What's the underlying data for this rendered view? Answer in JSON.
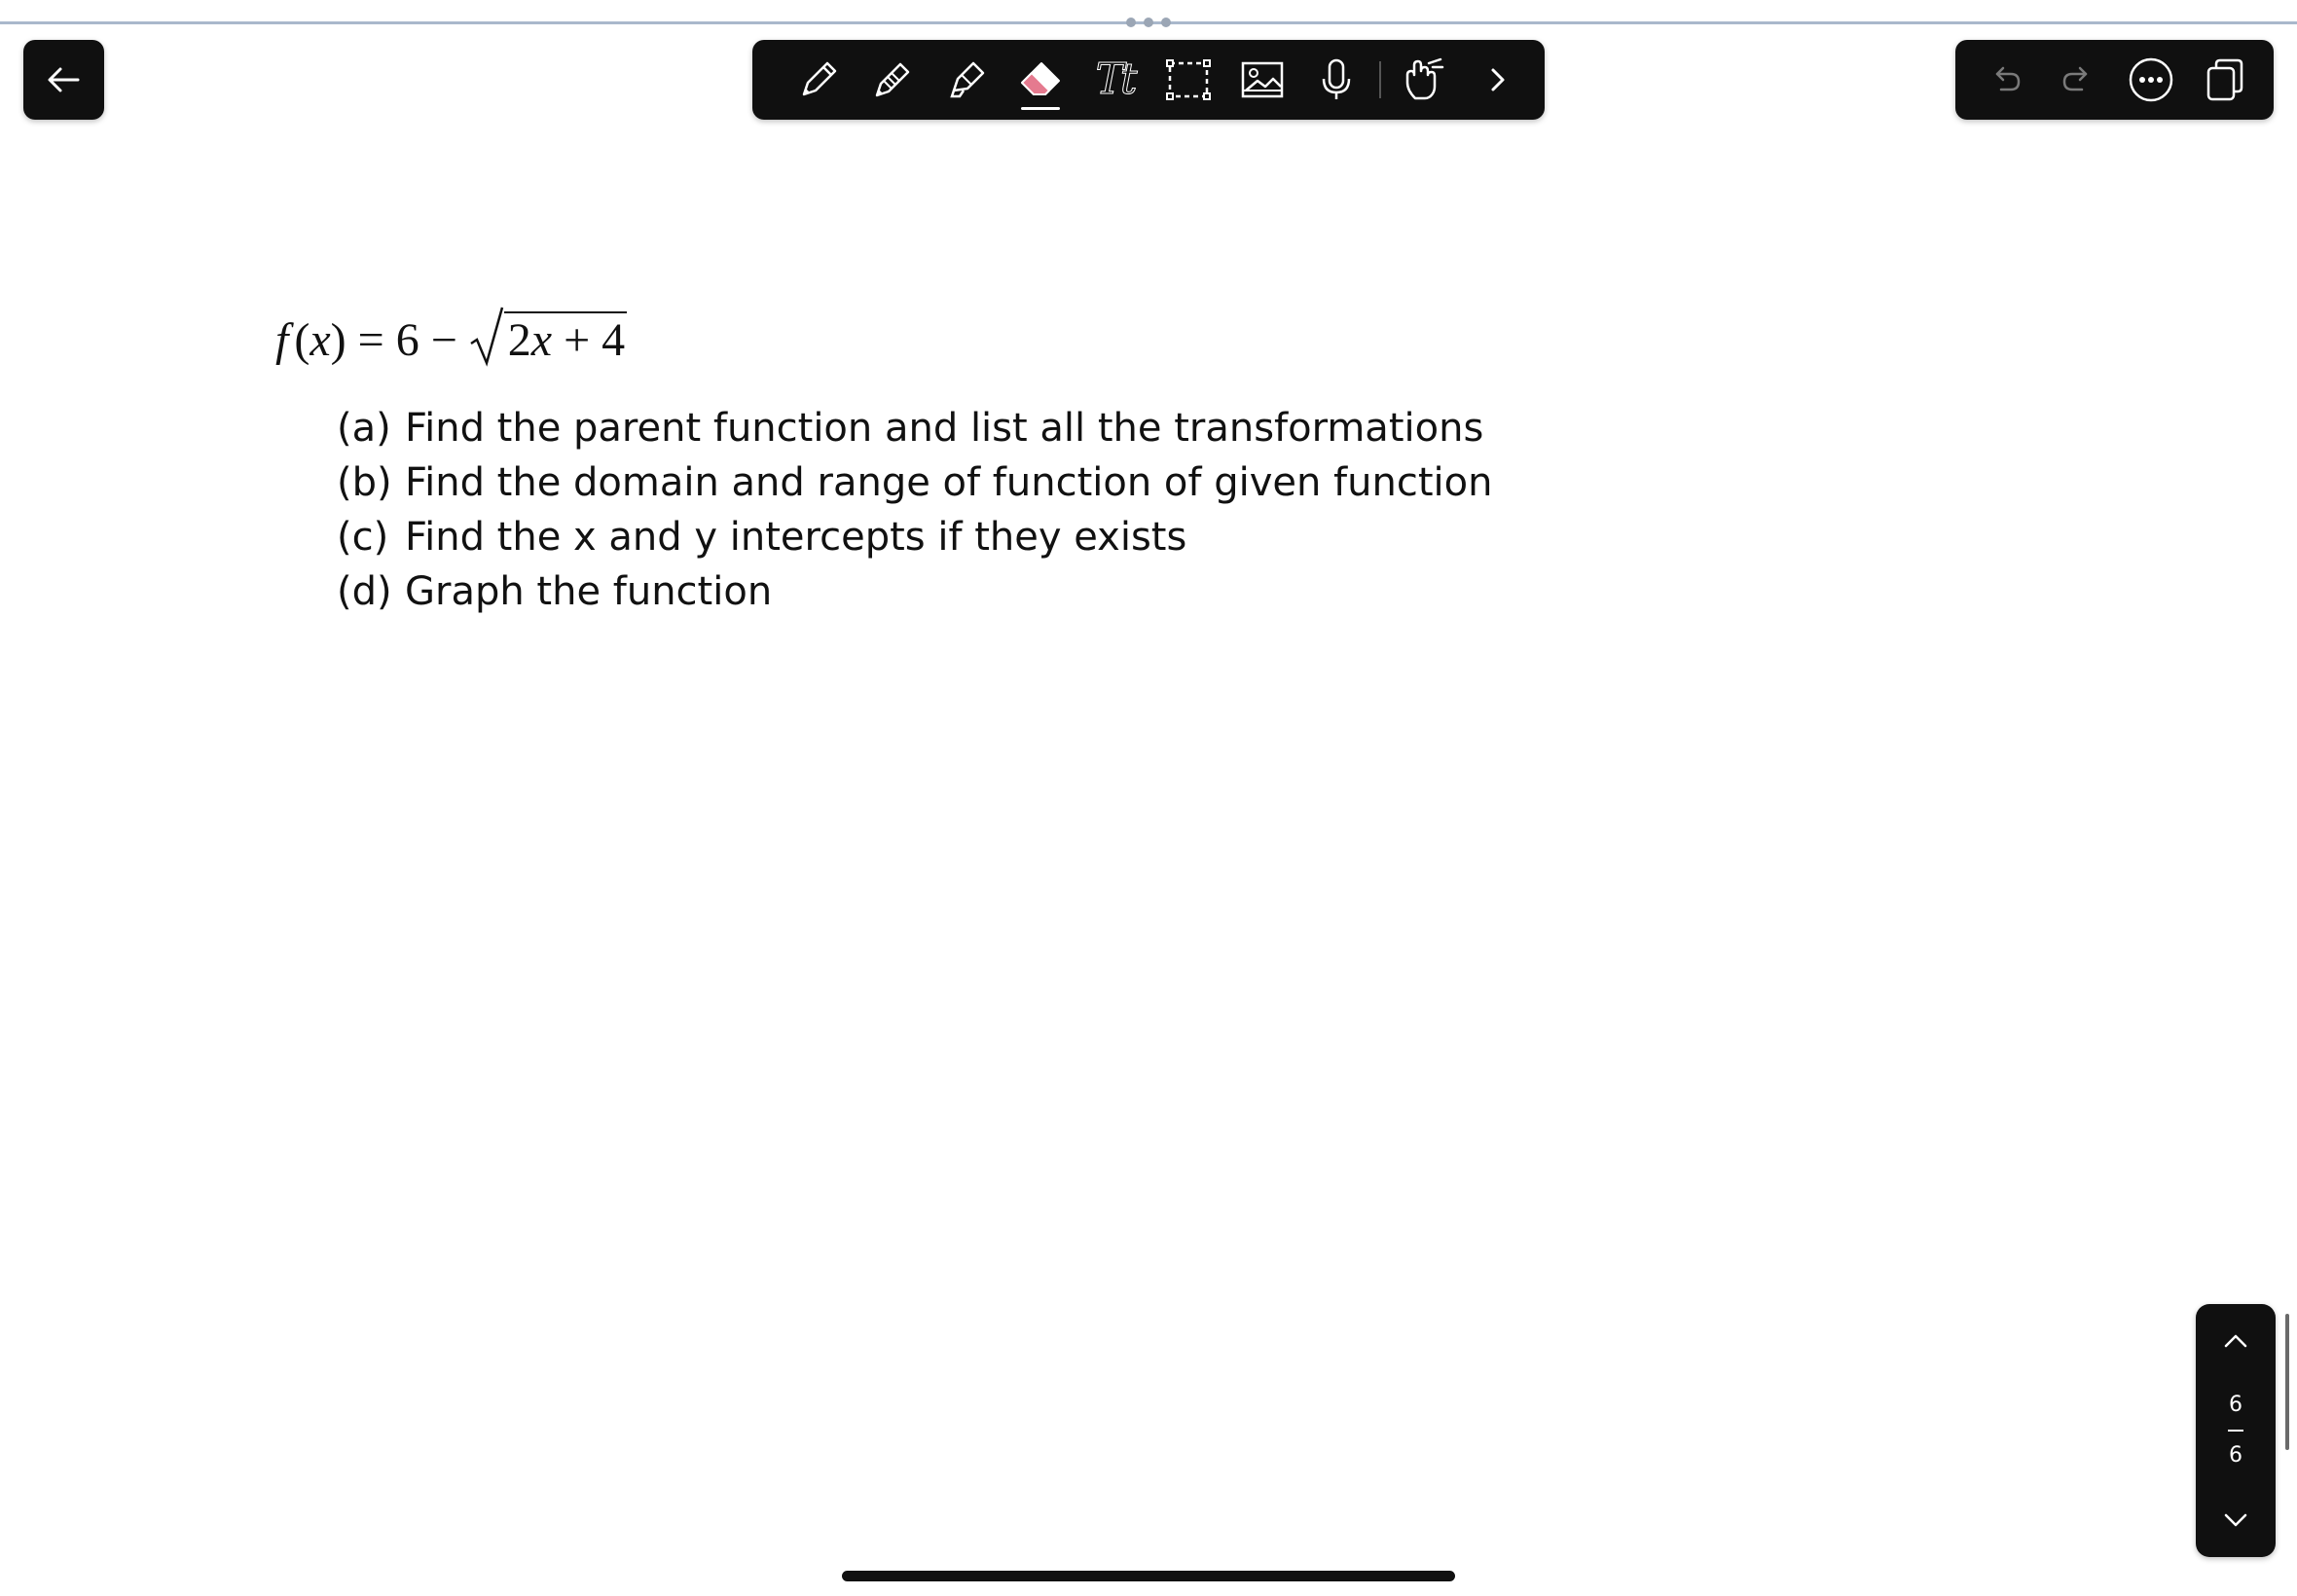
{
  "window": {
    "grabber_icon": "more-dots-icon"
  },
  "nav": {
    "back_icon": "arrow-left-icon"
  },
  "toolbar": {
    "tools": [
      {
        "name": "pen",
        "icon": "pen-icon"
      },
      {
        "name": "pencil",
        "icon": "pencil-icon"
      },
      {
        "name": "highlighter",
        "icon": "highlighter-icon"
      },
      {
        "name": "eraser",
        "icon": "eraser-icon",
        "active": true,
        "accent": "#e57a8f"
      },
      {
        "name": "text",
        "icon": "text-tool-icon",
        "glyph": "Tt"
      },
      {
        "name": "lasso",
        "icon": "lasso-select-icon"
      },
      {
        "name": "image",
        "icon": "image-icon"
      },
      {
        "name": "microphone",
        "icon": "microphone-icon"
      },
      {
        "name": "hand",
        "icon": "hand-touch-icon"
      },
      {
        "name": "more",
        "icon": "chevron-right-icon"
      }
    ]
  },
  "right_panel": {
    "undo_icon": "undo-icon",
    "redo_icon": "redo-icon",
    "more_icon": "more-circle-icon",
    "pages_icon": "pages-icon"
  },
  "document": {
    "formula": {
      "f": "f",
      "lparen": "(",
      "x": "x",
      "rparen": ")",
      "eq": " = 6 − ",
      "radicand_num": "2",
      "radicand_x": "x",
      "radicand_rest": " + 4"
    },
    "questions": [
      {
        "label": "(a)",
        "text": "Find the parent function and list all the transformations"
      },
      {
        "label": "(b)",
        "text": "Find the domain and range of function of given function"
      },
      {
        "label": "(c)",
        "text": "Find the x and y intercepts if they exists"
      },
      {
        "label": "(d)",
        "text": "Graph the function"
      }
    ]
  },
  "page_nav": {
    "current": "6",
    "total": "6",
    "up_icon": "chevron-up-icon",
    "down_icon": "chevron-down-icon"
  },
  "colors": {
    "panel_bg": "#101010",
    "top_line": "#a9b8cc",
    "eraser_accent": "#e57a8f"
  }
}
